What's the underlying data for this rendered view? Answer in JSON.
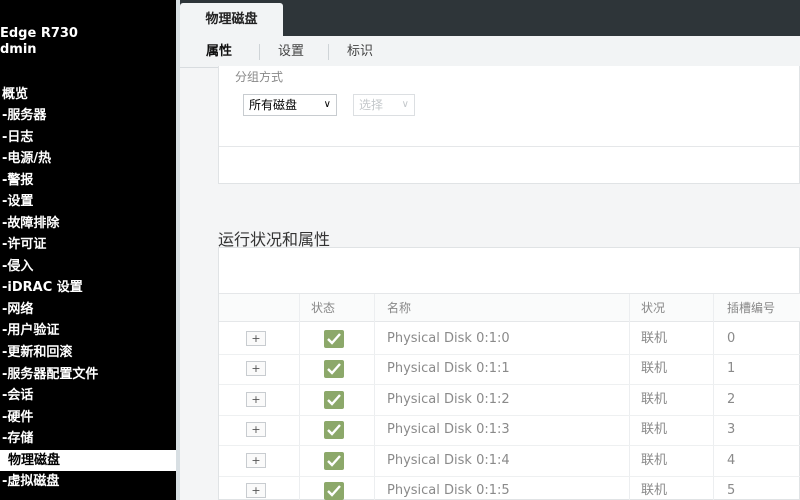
{
  "sidebar": {
    "brand_line1": "Edge R730",
    "brand_line2": "dmin",
    "items": [
      {
        "label": "概览"
      },
      {
        "label": "-服务器"
      },
      {
        "label": "-日志"
      },
      {
        "label": "-电源/热"
      },
      {
        "label": "-警报"
      },
      {
        "label": "-设置"
      },
      {
        "label": "-故障排除"
      },
      {
        "label": "-许可证"
      },
      {
        "label": "-侵入"
      },
      {
        "label": "-iDRAC 设置"
      },
      {
        "label": "-网络"
      },
      {
        "label": "-用户验证"
      },
      {
        "label": "-更新和回滚"
      },
      {
        "label": "-服务器配置文件"
      },
      {
        "label": "-会话"
      },
      {
        "label": "-硬件"
      },
      {
        "label": "-存储"
      },
      {
        "label": "物理磁盘"
      },
      {
        "label": "-虚拟磁盘"
      }
    ]
  },
  "tabs": {
    "active": "物理磁盘"
  },
  "subnav": {
    "properties": "属性",
    "setup": "设置",
    "identify": "标识"
  },
  "filters": {
    "groupby_label": "分组方式",
    "group_select": "所有磁盘",
    "choose_select": "选择"
  },
  "section": {
    "title": "运行状况和属性"
  },
  "table": {
    "headers": {
      "status": "状态",
      "name": "名称",
      "state": "状况",
      "slot": "插槽编号"
    },
    "rows": [
      {
        "name": "Physical Disk 0:1:0",
        "state": "联机",
        "slot": "0"
      },
      {
        "name": "Physical Disk 0:1:1",
        "state": "联机",
        "slot": "1"
      },
      {
        "name": "Physical Disk 0:1:2",
        "state": "联机",
        "slot": "2"
      },
      {
        "name": "Physical Disk 0:1:3",
        "state": "联机",
        "slot": "3"
      },
      {
        "name": "Physical Disk 0:1:4",
        "state": "联机",
        "slot": "4"
      },
      {
        "name": "Physical Disk 0:1:5",
        "state": "联机",
        "slot": "5"
      }
    ],
    "expand_symbol": "+"
  },
  "colors": {
    "status_ok": "#8ca86a",
    "topbar": "#2e3539",
    "sidebar": "#000000"
  }
}
